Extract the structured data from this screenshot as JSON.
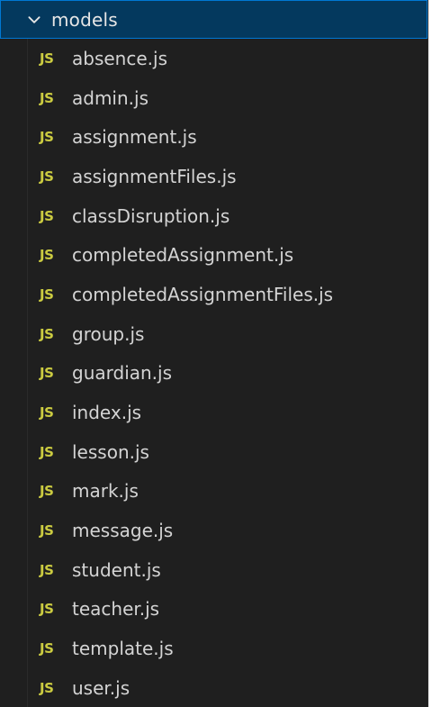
{
  "folder": {
    "name": "models",
    "icon": "chevron-down-icon",
    "expanded": true
  },
  "file_icon": {
    "label": "JS",
    "color": "#cbcb41"
  },
  "files": [
    {
      "name": "absence.js"
    },
    {
      "name": "admin.js"
    },
    {
      "name": "assignment.js"
    },
    {
      "name": "assignmentFiles.js"
    },
    {
      "name": "classDisruption.js"
    },
    {
      "name": "completedAssignment.js"
    },
    {
      "name": "completedAssignmentFiles.js"
    },
    {
      "name": "group.js"
    },
    {
      "name": "guardian.js"
    },
    {
      "name": "index.js"
    },
    {
      "name": "lesson.js"
    },
    {
      "name": "mark.js"
    },
    {
      "name": "message.js"
    },
    {
      "name": "student.js"
    },
    {
      "name": "teacher.js"
    },
    {
      "name": "template.js"
    },
    {
      "name": "user.js"
    }
  ],
  "colors": {
    "background": "#1f1f1f",
    "selected_row": "#04395e",
    "focus_border": "#0078d4",
    "text": "#d4d4d4"
  }
}
